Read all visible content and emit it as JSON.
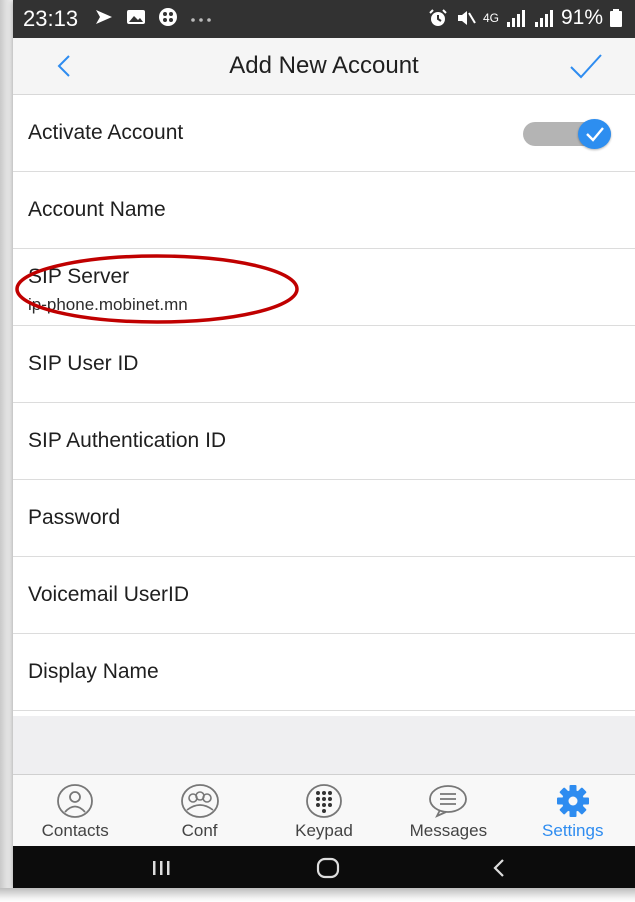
{
  "status_bar": {
    "time": "23:13",
    "battery": "91%",
    "network": "4G",
    "icons": [
      "cast-icon",
      "gallery-icon",
      "app-icon",
      "more-dots-icon",
      "alarm-icon",
      "mute-icon",
      "signal-icon",
      "signal-icon",
      "battery-icon"
    ]
  },
  "header": {
    "title": "Add New Account",
    "back_icon": "chevron-left-icon",
    "done_icon": "checkmark-icon"
  },
  "settings": {
    "activate": {
      "label": "Activate Account",
      "enabled": true
    },
    "account_name": {
      "label": "Account Name"
    },
    "sip_server": {
      "label": "SIP Server",
      "value": "ip-phone.mobinet.mn"
    },
    "sip_user_id": {
      "label": "SIP User ID"
    },
    "sip_auth_id": {
      "label": "SIP Authentication ID"
    },
    "password": {
      "label": "Password"
    },
    "voicemail_userid": {
      "label": "Voicemail UserID"
    },
    "display_name": {
      "label": "Display Name"
    }
  },
  "tabs": [
    {
      "label": "Contacts",
      "icon": "contacts-icon",
      "active": false
    },
    {
      "label": "Conf",
      "icon": "conference-icon",
      "active": false
    },
    {
      "label": "Keypad",
      "icon": "keypad-icon",
      "active": false
    },
    {
      "label": "Messages",
      "icon": "messages-icon",
      "active": false
    },
    {
      "label": "Settings",
      "icon": "gear-icon",
      "active": true
    }
  ],
  "nav_bar": {
    "buttons": [
      "recent-apps-icon",
      "home-icon",
      "back-icon"
    ]
  },
  "colors": {
    "accent": "#2e8cf0",
    "annotation": "#c00000",
    "status_bar": "#323232",
    "nav_bar": "#0c0c0c"
  }
}
